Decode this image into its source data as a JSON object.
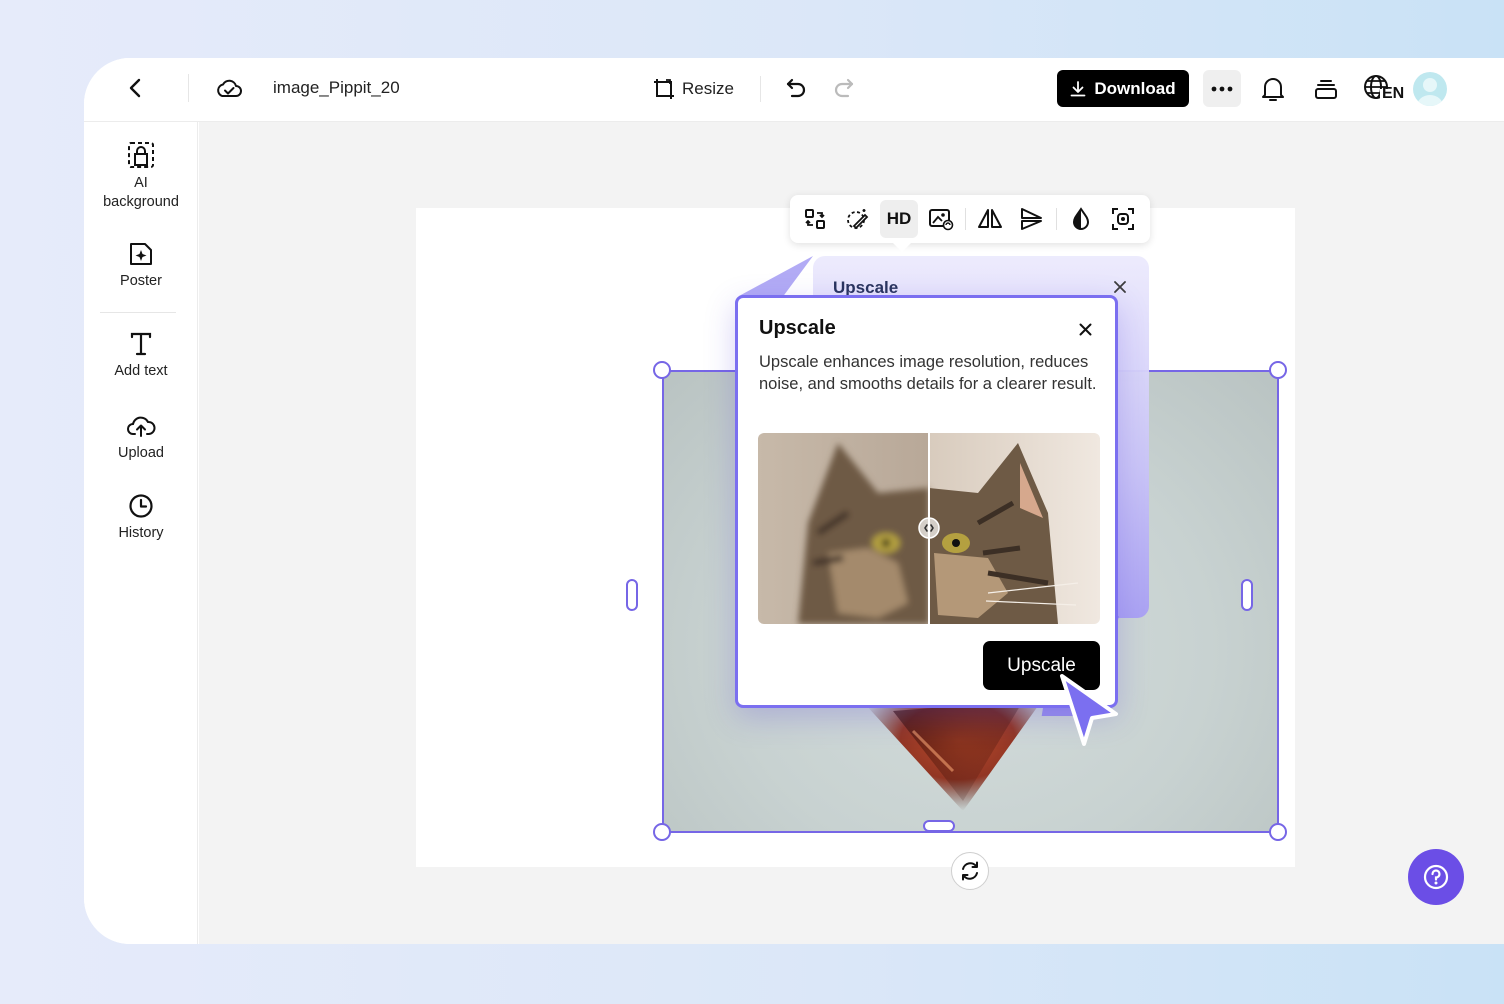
{
  "topbar": {
    "back_icon": "chevron-left-icon",
    "cloud_icon": "cloud-sync-icon",
    "filename": "image_Pippit_20",
    "resize_label": "Resize",
    "undo_icon": "undo-icon",
    "redo_icon": "redo-icon",
    "download_label": "Download",
    "more_icon": "more-dots-icon",
    "bell_icon": "bell-icon",
    "layers_icon": "layers-icon",
    "language_icon": "globe-language-icon",
    "language_code": "EN",
    "avatar_icon": "user-avatar-icon"
  },
  "sidebar": {
    "items": [
      {
        "label": "AI background",
        "icon": "ai-background-icon"
      },
      {
        "label": "Poster",
        "icon": "poster-icon"
      },
      {
        "label": "Add text",
        "icon": "text-icon"
      },
      {
        "label": "Upload",
        "icon": "cloud-upload-icon"
      },
      {
        "label": "History",
        "icon": "clock-icon"
      }
    ]
  },
  "float_toolbar": {
    "hd_label": "HD",
    "tools": [
      "replace-icon",
      "magic-eraser-icon",
      "hd-icon",
      "image-edit-icon",
      "flip-horizontal-icon",
      "flip-vertical-icon",
      "opacity-icon",
      "crop-focus-icon"
    ]
  },
  "back_panel": {
    "title": "Upscale"
  },
  "popup": {
    "title": "Upscale",
    "description": "Upscale enhances image resolution, reduces noise, and smooths details for a clearer result.",
    "button_label": "Upscale"
  },
  "colors": {
    "accent": "#7666e6",
    "help_button": "#6b4ee6",
    "primary_button": "#000000"
  }
}
